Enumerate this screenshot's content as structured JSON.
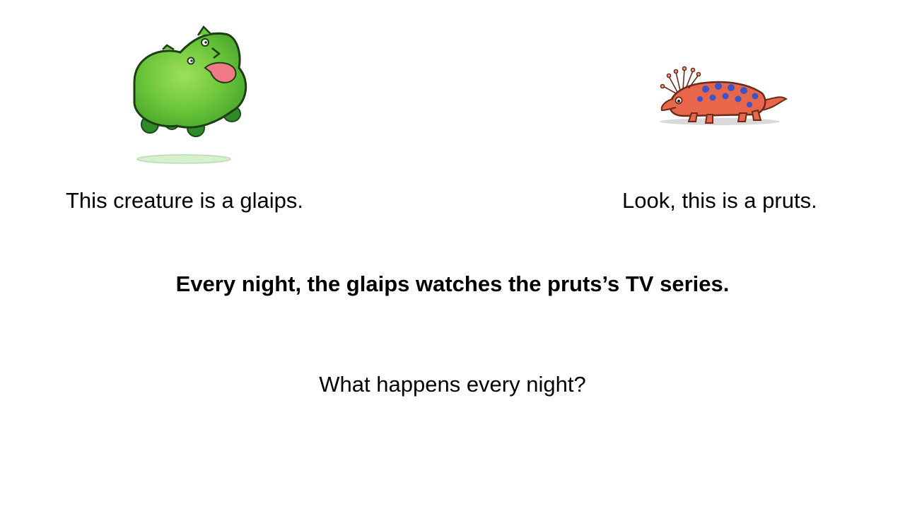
{
  "slide": {
    "left_caption": "This creature is a glaips.",
    "right_caption": "Look, this is a pruts.",
    "statement": "Every night, the glaips watches the pruts’s TV series.",
    "question": "What happens every night?"
  },
  "illustrations": {
    "left": "glaips-illustration",
    "right": "pruts-illustration"
  },
  "colors": {
    "glaips_body": "#6cc63a",
    "glaips_feet": "#2f8a2a",
    "pruts_body": "#e8674a",
    "pruts_spots": "#3b55c9"
  }
}
